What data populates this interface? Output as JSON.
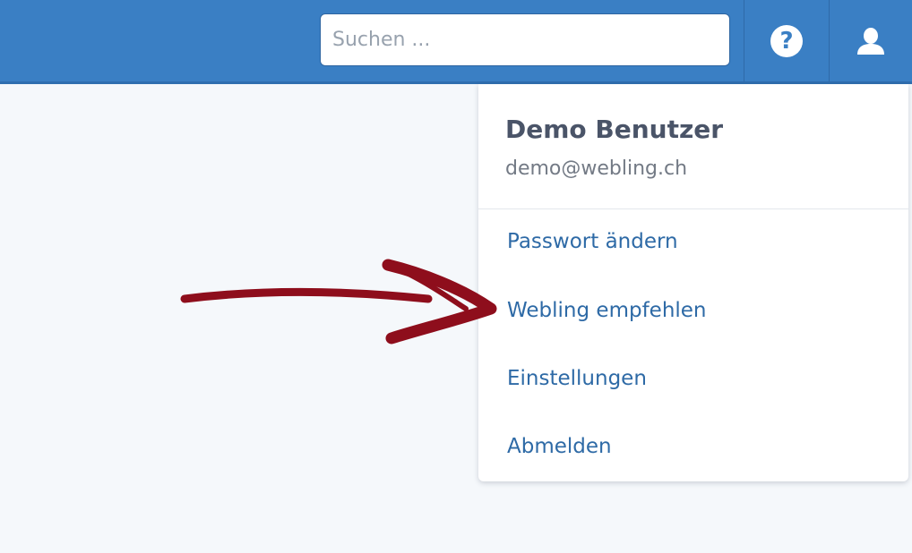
{
  "header": {
    "search_placeholder": "Suchen ...",
    "help_icon": "question-circle-icon",
    "user_icon": "user-icon",
    "accent_color": "#3a7fc4"
  },
  "user_menu": {
    "name": "Demo Benutzer",
    "email": "demo@webling.ch",
    "items": [
      {
        "label": "Passwort ändern"
      },
      {
        "label": "Webling empfehlen"
      },
      {
        "label": "Einstellungen"
      },
      {
        "label": "Abmelden"
      }
    ]
  },
  "annotation": {
    "arrow_color": "#8e0e1c",
    "arrow_icon": "hand-drawn-arrow-icon"
  }
}
